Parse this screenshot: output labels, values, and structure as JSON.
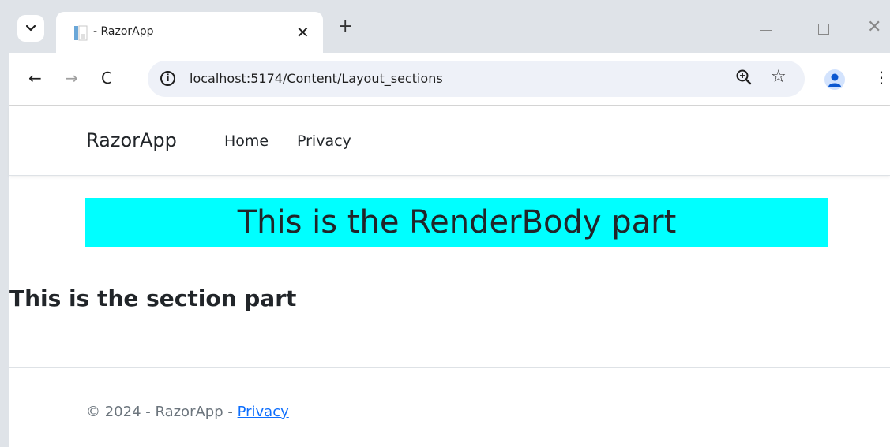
{
  "browser": {
    "tab": {
      "title": "- RazorApp",
      "close": "✕"
    },
    "new_tab": "+",
    "window": {
      "close": "✕"
    },
    "nav": {
      "back": "←",
      "forward": "→",
      "reload": "C"
    },
    "address": {
      "url": "localhost:5174/Content/Layout_sections",
      "info": "i"
    },
    "icons": {
      "zoom": "zoom-icon",
      "star": "☆",
      "menu": "⋮"
    }
  },
  "page": {
    "navbar": {
      "brand": "RazorApp",
      "links": [
        {
          "label": "Home"
        },
        {
          "label": "Privacy"
        }
      ]
    },
    "render_body": "This is the RenderBody part",
    "section_heading": "This is the section part",
    "footer": {
      "prefix": "© 2024 - RazorApp - ",
      "link": "Privacy"
    }
  },
  "colors": {
    "render_body_bg": "#00ffff",
    "link": "#0d6efd",
    "text": "#212529",
    "footer_text": "#6c757d"
  }
}
